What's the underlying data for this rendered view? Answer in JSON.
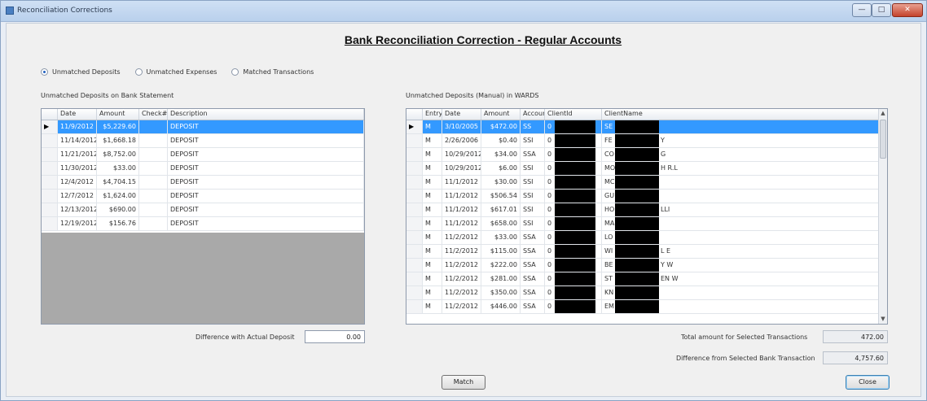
{
  "window": {
    "title": "Reconciliation Corrections",
    "min_label": "—",
    "max_label": "□",
    "close_label": "✕"
  },
  "page_title": "Bank Reconciliation Correction - Regular Accounts",
  "radios": [
    {
      "label": "Unmatched Deposits",
      "checked": true
    },
    {
      "label": "Unmatched Expenses",
      "checked": false
    },
    {
      "label": "Matched Transactions",
      "checked": false
    }
  ],
  "left_grid": {
    "caption": "Unmatched Deposits on Bank Statement",
    "columns": [
      "Date",
      "Amount",
      "Check#",
      "Description"
    ],
    "rows": [
      [
        "11/9/2012",
        "$5,229.60",
        "",
        "DEPOSIT"
      ],
      [
        "11/14/2012",
        "$1,668.18",
        "",
        "DEPOSIT"
      ],
      [
        "11/21/2012",
        "$8,752.00",
        "",
        "DEPOSIT"
      ],
      [
        "11/30/2012",
        "$33.00",
        "",
        "DEPOSIT"
      ],
      [
        "12/4/2012",
        "$4,704.15",
        "",
        "DEPOSIT"
      ],
      [
        "12/7/2012",
        "$1,624.00",
        "",
        "DEPOSIT"
      ],
      [
        "12/13/2012",
        "$690.00",
        "",
        "DEPOSIT"
      ],
      [
        "12/19/2012",
        "$156.76",
        "",
        "DEPOSIT"
      ]
    ]
  },
  "right_grid": {
    "caption": "Unmatched Deposits (Manual) in WARDS",
    "columns": [
      "Entry",
      "Date",
      "Amount",
      "Account",
      "ClientId",
      "ClientName"
    ],
    "rows": [
      [
        "M",
        "3/10/2005",
        "$472.00",
        "SS",
        "0",
        "SE"
      ],
      [
        "M",
        "2/26/2006",
        "$0.40",
        "SSI",
        "0",
        "FE",
        "Y"
      ],
      [
        "M",
        "10/29/2012",
        "$34.00",
        "SSA",
        "0",
        "CO",
        "G"
      ],
      [
        "M",
        "10/29/2012",
        "$6.00",
        "SSI",
        "0",
        "MO",
        "H R.L"
      ],
      [
        "M",
        "11/1/2012",
        "$30.00",
        "SSI",
        "0",
        "MC",
        ""
      ],
      [
        "M",
        "11/1/2012",
        "$506.54",
        "SSI",
        "0",
        "GU",
        ""
      ],
      [
        "M",
        "11/1/2012",
        "$617.01",
        "SSI",
        "0",
        "HO",
        "LLI"
      ],
      [
        "M",
        "11/1/2012",
        "$658.00",
        "SSI",
        "0",
        "MA",
        ""
      ],
      [
        "M",
        "11/2/2012",
        "$33.00",
        "SSA",
        "0",
        "LO",
        ""
      ],
      [
        "M",
        "11/2/2012",
        "$115.00",
        "SSA",
        "0",
        "WI",
        "L E"
      ],
      [
        "M",
        "11/2/2012",
        "$222.00",
        "SSA",
        "0",
        "BE",
        "Y W"
      ],
      [
        "M",
        "11/2/2012",
        "$281.00",
        "SSA",
        "0",
        "ST",
        "EN W"
      ],
      [
        "M",
        "11/2/2012",
        "$350.00",
        "SSA",
        "0",
        "KN",
        ""
      ],
      [
        "M",
        "11/2/2012",
        "$446.00",
        "SSA",
        "0",
        "EM",
        ""
      ]
    ]
  },
  "difference_label": "Difference with Actual Deposit",
  "difference_value": "0.00",
  "total_label": "Total amount for Selected Transactions",
  "total_value": "472.00",
  "diff_bank_label": "Difference from Selected Bank Transaction",
  "diff_bank_value": "4,757.60",
  "match_button": "Match",
  "close_button": "Close"
}
